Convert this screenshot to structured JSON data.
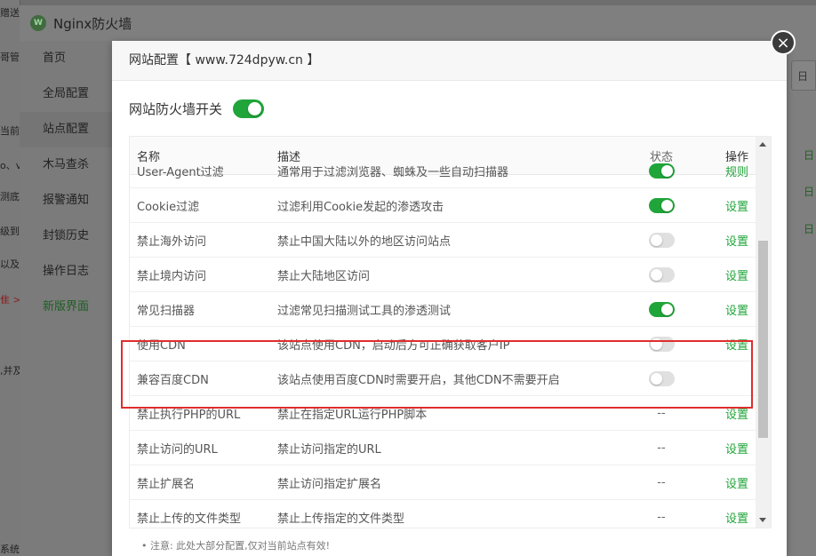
{
  "background": {
    "left_fragments": [
      "赠送",
      "哥管理",
      "当前位",
      "o、v",
      "测底",
      "级到",
      "以及",
      "隹 >",
      ",并及",
      "系统"
    ],
    "app_title": "Nginx防火墙",
    "nav": [
      "首页",
      "全局配置",
      "站点配置",
      "木马查杀",
      "报警通知",
      "封锁历史",
      "操作日志",
      "新版界面"
    ],
    "date_box": "日",
    "row_tags": [
      "日",
      "日",
      "日"
    ]
  },
  "modal": {
    "title": "网站配置【 www.724dpyw.cn 】",
    "close": "×",
    "switch_label": "网站防火墙开关",
    "switch_on": true,
    "columns": {
      "name": "名称",
      "desc": "描述",
      "status": "状态",
      "op": "操作"
    },
    "rows": [
      {
        "name": "User-Agent过滤",
        "desc": "通常用于过滤浏览器、蜘蛛及一些自动扫描器",
        "status": "on",
        "op": "规则"
      },
      {
        "name": "Cookie过滤",
        "desc": "过滤利用Cookie发起的渗透攻击",
        "status": "on",
        "op": "设置"
      },
      {
        "name": "禁止海外访问",
        "desc": "禁止中国大陆以外的地区访问站点",
        "status": "off",
        "op": "设置"
      },
      {
        "name": "禁止境内访问",
        "desc": "禁止大陆地区访问",
        "status": "off",
        "op": "设置"
      },
      {
        "name": "常见扫描器",
        "desc": "过滤常见扫描测试工具的渗透测试",
        "status": "on",
        "op": "设置"
      },
      {
        "name": "使用CDN",
        "desc": "该站点使用CDN，启动后方可正确获取客户IP",
        "status": "off",
        "op": "设置"
      },
      {
        "name": "兼容百度CDN",
        "desc": "该站点使用百度CDN时需要开启，其他CDN不需要开启",
        "status": "off",
        "op": ""
      },
      {
        "name": "禁止执行PHP的URL",
        "desc": "禁止在指定URL运行PHP脚本",
        "status": "--",
        "op": "设置"
      },
      {
        "name": "禁止访问的URL",
        "desc": "禁止访问指定的URL",
        "status": "--",
        "op": "设置"
      },
      {
        "name": "禁止扩展名",
        "desc": "禁止访问指定扩展名",
        "status": "--",
        "op": "设置"
      },
      {
        "name": "禁止上传的文件类型",
        "desc": "禁止上传指定的文件类型",
        "status": "--",
        "op": "设置"
      }
    ],
    "note": "• 注意: 此处大部分配置,仅对当前站点有效!",
    "colors": {
      "accent_green": "#20a53a",
      "highlight_red": "#e02d2d"
    }
  }
}
